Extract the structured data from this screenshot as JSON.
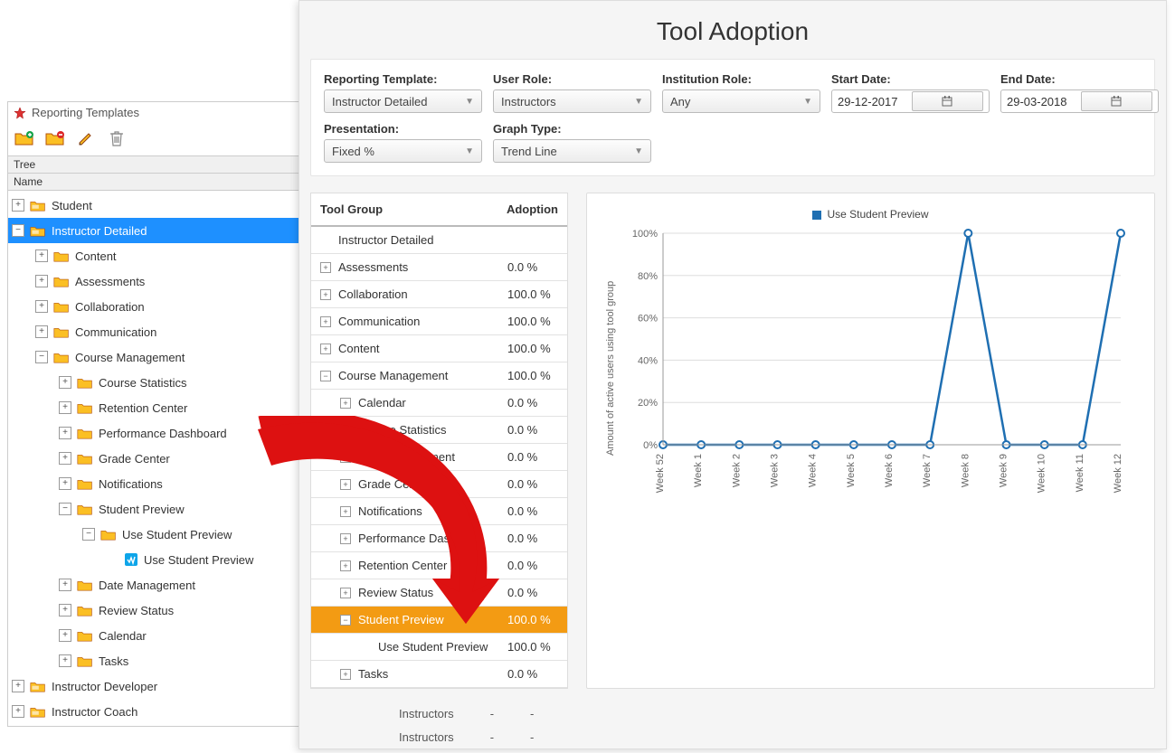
{
  "tree_panel": {
    "title": "Reporting Templates",
    "tree_label": "Tree",
    "name_label": "Name",
    "items": [
      {
        "level": 0,
        "twisty": "+",
        "icon": "folder-special",
        "label": "Student"
      },
      {
        "level": 0,
        "twisty": "-",
        "icon": "folder-special",
        "label": "Instructor Detailed",
        "selected": true
      },
      {
        "level": 1,
        "twisty": "+",
        "icon": "folder",
        "label": "Content"
      },
      {
        "level": 1,
        "twisty": "+",
        "icon": "folder",
        "label": "Assessments"
      },
      {
        "level": 1,
        "twisty": "+",
        "icon": "folder",
        "label": "Collaboration"
      },
      {
        "level": 1,
        "twisty": "+",
        "icon": "folder",
        "label": "Communication"
      },
      {
        "level": 1,
        "twisty": "-",
        "icon": "folder",
        "label": "Course Management"
      },
      {
        "level": 2,
        "twisty": "+",
        "icon": "folder",
        "label": "Course Statistics"
      },
      {
        "level": 2,
        "twisty": "+",
        "icon": "folder",
        "label": "Retention Center"
      },
      {
        "level": 2,
        "twisty": "+",
        "icon": "folder",
        "label": "Performance Dashboard"
      },
      {
        "level": 2,
        "twisty": "+",
        "icon": "folder",
        "label": "Grade Center"
      },
      {
        "level": 2,
        "twisty": "+",
        "icon": "folder",
        "label": "Notifications"
      },
      {
        "level": 2,
        "twisty": "-",
        "icon": "folder",
        "label": "Student Preview"
      },
      {
        "level": 3,
        "twisty": "-",
        "icon": "folder",
        "label": "Use Student Preview"
      },
      {
        "level": 4,
        "twisty": " ",
        "icon": "leaf",
        "label": "Use Student Preview"
      },
      {
        "level": 2,
        "twisty": "+",
        "icon": "folder",
        "label": "Date Management"
      },
      {
        "level": 2,
        "twisty": "+",
        "icon": "folder",
        "label": "Review Status"
      },
      {
        "level": 2,
        "twisty": "+",
        "icon": "folder",
        "label": "Calendar"
      },
      {
        "level": 2,
        "twisty": "+",
        "icon": "folder",
        "label": "Tasks"
      },
      {
        "level": 0,
        "twisty": "+",
        "icon": "folder-special",
        "label": "Instructor Developer"
      },
      {
        "level": 0,
        "twisty": "+",
        "icon": "folder-special",
        "label": "Instructor Coach"
      }
    ]
  },
  "report": {
    "title": "Tool Adoption",
    "filters": {
      "template_label": "Reporting Template:",
      "template_value": "Instructor Detailed",
      "role_label": "User Role:",
      "role_value": "Instructors",
      "inst_label": "Institution Role:",
      "inst_value": "Any",
      "start_label": "Start Date:",
      "start_value": "29-12-2017",
      "end_label": "End Date:",
      "end_value": "29-03-2018",
      "pres_label": "Presentation:",
      "pres_value": "Fixed %",
      "graph_label": "Graph Type:",
      "graph_value": "Trend Line"
    },
    "table": {
      "col1": "Tool Group",
      "col2": "Adoption",
      "rows": [
        {
          "exp": "",
          "indent": 0,
          "name": "Instructor Detailed",
          "val": ""
        },
        {
          "exp": "+",
          "indent": 0,
          "name": "Assessments",
          "val": "0.0 %"
        },
        {
          "exp": "+",
          "indent": 0,
          "name": "Collaboration",
          "val": "100.0 %"
        },
        {
          "exp": "+",
          "indent": 0,
          "name": "Communication",
          "val": "100.0 %"
        },
        {
          "exp": "+",
          "indent": 0,
          "name": "Content",
          "val": "100.0 %"
        },
        {
          "exp": "-",
          "indent": 0,
          "name": "Course Management",
          "val": "100.0 %"
        },
        {
          "exp": "+",
          "indent": 1,
          "name": "Calendar",
          "val": "0.0 %"
        },
        {
          "exp": "+",
          "indent": 1,
          "name": "Course Statistics",
          "val": "0.0 %"
        },
        {
          "exp": "+",
          "indent": 1,
          "name": "Date Management",
          "val": "0.0 %"
        },
        {
          "exp": "+",
          "indent": 1,
          "name": "Grade Center",
          "val": "0.0 %"
        },
        {
          "exp": "+",
          "indent": 1,
          "name": "Notifications",
          "val": "0.0 %"
        },
        {
          "exp": "+",
          "indent": 1,
          "name": "Performance Dashbo…",
          "val": "0.0 %"
        },
        {
          "exp": "+",
          "indent": 1,
          "name": "Retention Center",
          "val": "0.0 %"
        },
        {
          "exp": "+",
          "indent": 1,
          "name": "Review Status",
          "val": "0.0 %"
        },
        {
          "exp": "-",
          "indent": 1,
          "name": "Student Preview",
          "val": "100.0 %",
          "hl": true
        },
        {
          "exp": "",
          "indent": 2,
          "name": "Use Student Preview",
          "val": "100.0 %"
        },
        {
          "exp": "+",
          "indent": 1,
          "name": "Tasks",
          "val": "0.0 %"
        }
      ],
      "footer_rows": [
        {
          "a": "Instructors",
          "b": "-",
          "c": "-"
        },
        {
          "a": "Instructors",
          "b": "-",
          "c": "-"
        }
      ]
    },
    "legend": "Use Student Preview"
  },
  "chart_data": {
    "type": "line",
    "title": "",
    "ylabel": "Amount of active users using tool group",
    "xlabel": "",
    "ylim": [
      0,
      100
    ],
    "yticks": [
      "0%",
      "20%",
      "40%",
      "60%",
      "80%",
      "100%"
    ],
    "categories": [
      "Week 52",
      "Week 1",
      "Week 2",
      "Week 3",
      "Week 4",
      "Week 5",
      "Week 6",
      "Week 7",
      "Week 8",
      "Week 9",
      "Week 10",
      "Week 11",
      "Week 12"
    ],
    "series": [
      {
        "name": "Use Student Preview",
        "color": "#1f6fb2",
        "values": [
          0,
          0,
          0,
          0,
          0,
          0,
          0,
          0,
          100,
          0,
          0,
          0,
          100
        ]
      }
    ]
  }
}
